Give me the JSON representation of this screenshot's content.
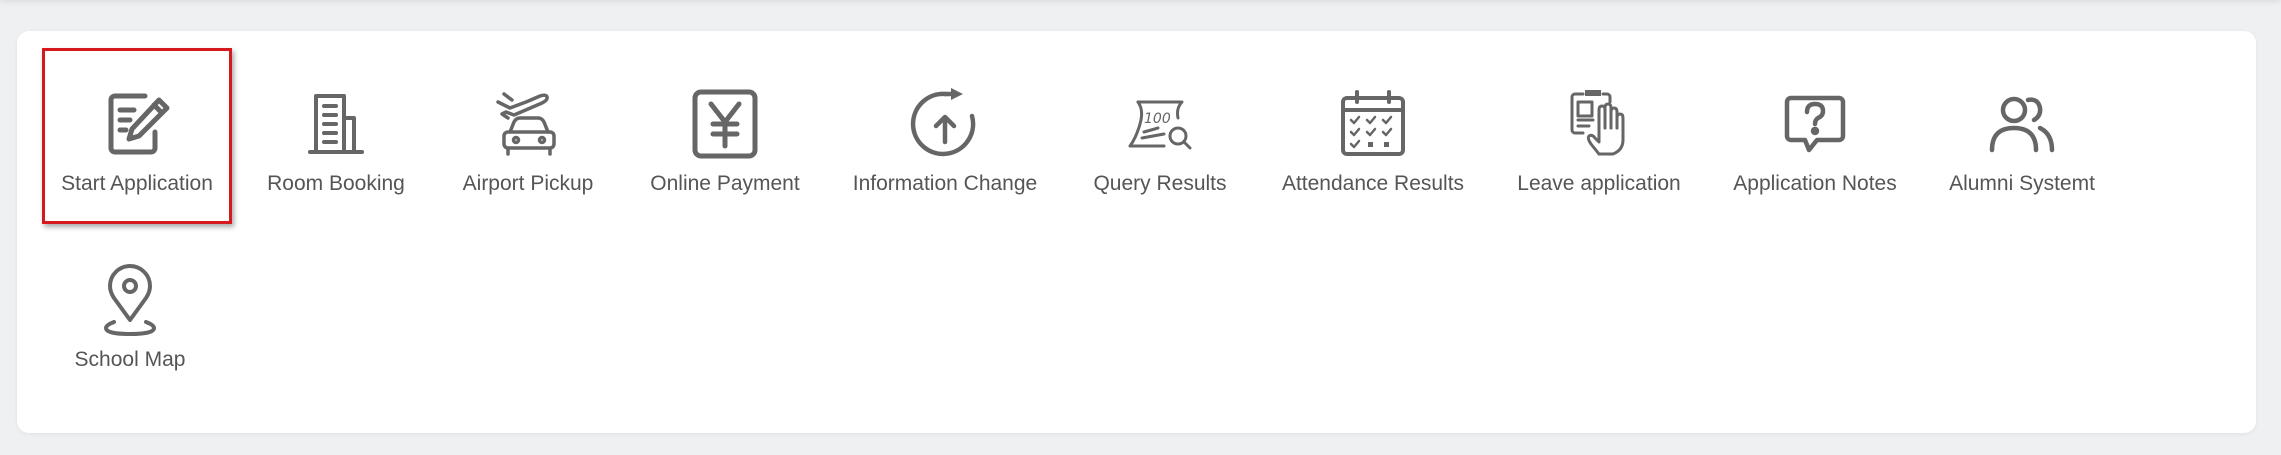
{
  "colors": {
    "icon": "#666666",
    "label": "#555555",
    "selection": "#d6191e",
    "card": "#ffffff",
    "background": "#eef0f2"
  },
  "selected_item": "start-application",
  "items": [
    {
      "label": "Start Application",
      "icon": "edit-icon"
    },
    {
      "label": "Room Booking",
      "icon": "building-icon"
    },
    {
      "label": "Airport Pickup",
      "icon": "plane-car-icon"
    },
    {
      "label": "Online Payment",
      "icon": "yen-icon"
    },
    {
      "label": "Information Change",
      "icon": "refresh-upload-icon"
    },
    {
      "label": "Query Results",
      "icon": "scroll-search-icon"
    },
    {
      "label": "Attendance Results",
      "icon": "calendar-check-icon"
    },
    {
      "label": "Leave application",
      "icon": "hand-document-icon"
    },
    {
      "label": "Application Notes",
      "icon": "question-chat-icon"
    },
    {
      "label": "Alumni Systemt",
      "icon": "users-icon"
    },
    {
      "label": "School Map",
      "icon": "map-pin-icon"
    }
  ]
}
